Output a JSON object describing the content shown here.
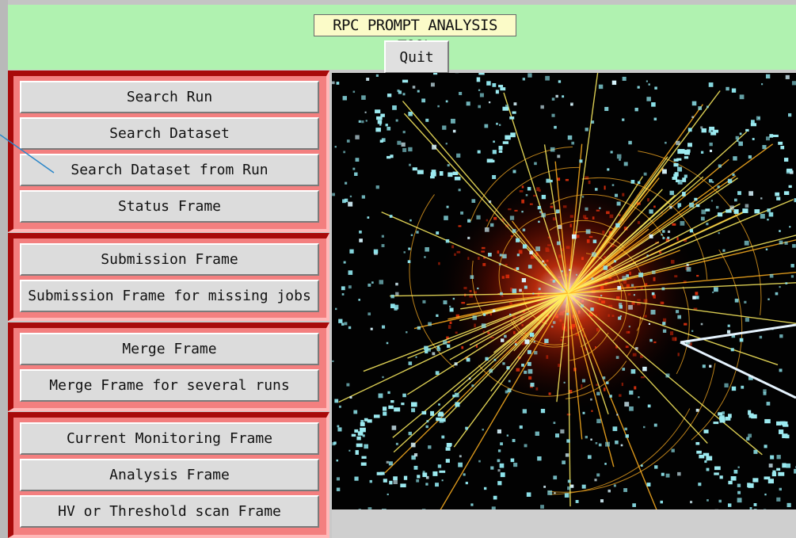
{
  "header": {
    "title": "RPC PROMPT ANALYSIS TOOL",
    "quit_label": "Quit"
  },
  "groups": [
    {
      "buttons": [
        {
          "label": "Search Run"
        },
        {
          "label": "Search Dataset"
        },
        {
          "label": "Search Dataset from Run"
        },
        {
          "label": "Status Frame"
        }
      ]
    },
    {
      "buttons": [
        {
          "label": "Submission Frame"
        },
        {
          "label": "Submission Frame for missing jobs"
        }
      ]
    },
    {
      "buttons": [
        {
          "label": "Merge Frame"
        },
        {
          "label": "Merge Frame for several runs"
        }
      ]
    },
    {
      "buttons": [
        {
          "label": "Current Monitoring Frame"
        },
        {
          "label": "Analysis Frame"
        },
        {
          "label": "HV or Threshold scan Frame"
        }
      ]
    }
  ],
  "colors": {
    "header_bg": "#b0f2b0",
    "title_bg": "#fbfbc8",
    "panel_bg": "#f37f7f",
    "panel_border": "#a80a0a",
    "button_bg": "#dcdcdc"
  }
}
